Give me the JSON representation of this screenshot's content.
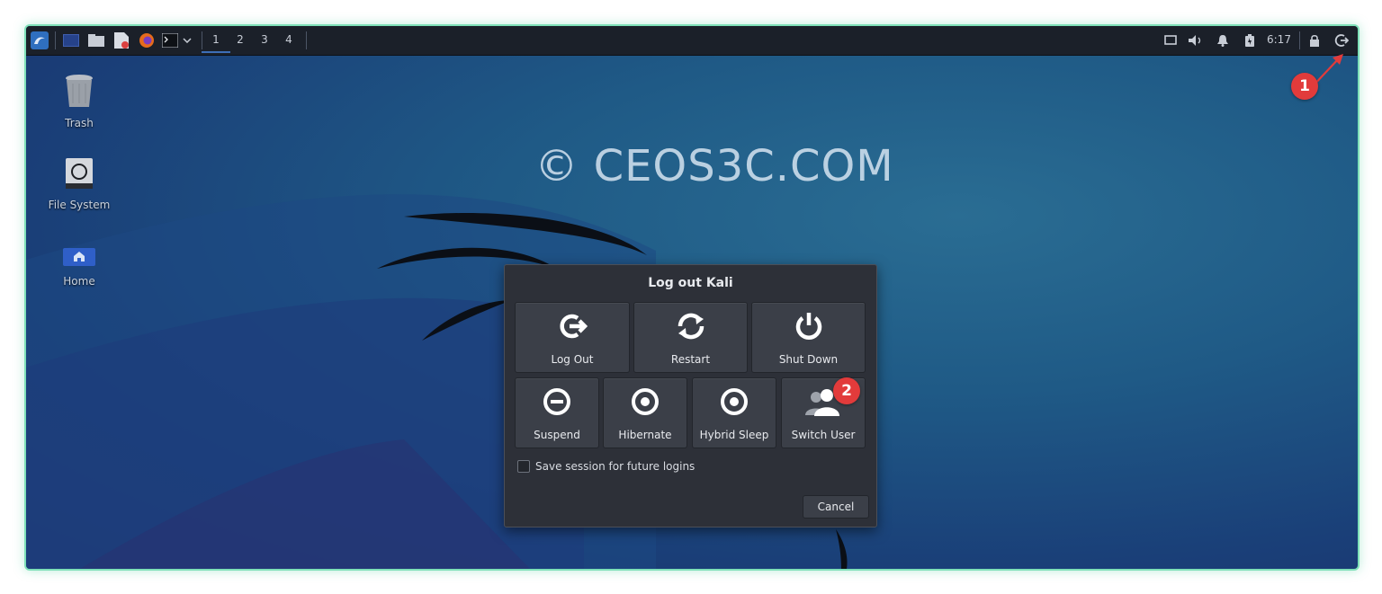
{
  "watermark": "© CEOS3C.COM",
  "panel": {
    "workspaces": [
      "1",
      "2",
      "3",
      "4"
    ],
    "active_workspace": "1",
    "clock": "6:17",
    "tray_icons": [
      "display-icon",
      "volume-icon",
      "notification-bell-icon",
      "battery-icon",
      "lock-icon",
      "logout-icon"
    ]
  },
  "desktop": {
    "icons": [
      {
        "label": "Trash",
        "icon": "trash-icon"
      },
      {
        "label": "File System",
        "icon": "drive-icon"
      },
      {
        "label": "Home",
        "icon": "home-folder-icon"
      }
    ]
  },
  "dialog": {
    "title": "Log out Kali",
    "buttons_row1": [
      "Log Out",
      "Restart",
      "Shut Down"
    ],
    "buttons_row2": [
      "Suspend",
      "Hibernate",
      "Hybrid Sleep",
      "Switch User"
    ],
    "save_session_label": "Save session for future logins",
    "save_session_checked": false,
    "cancel_label": "Cancel"
  },
  "annotations": {
    "step1": "1",
    "step2": "2",
    "color": "#e23b3b"
  }
}
